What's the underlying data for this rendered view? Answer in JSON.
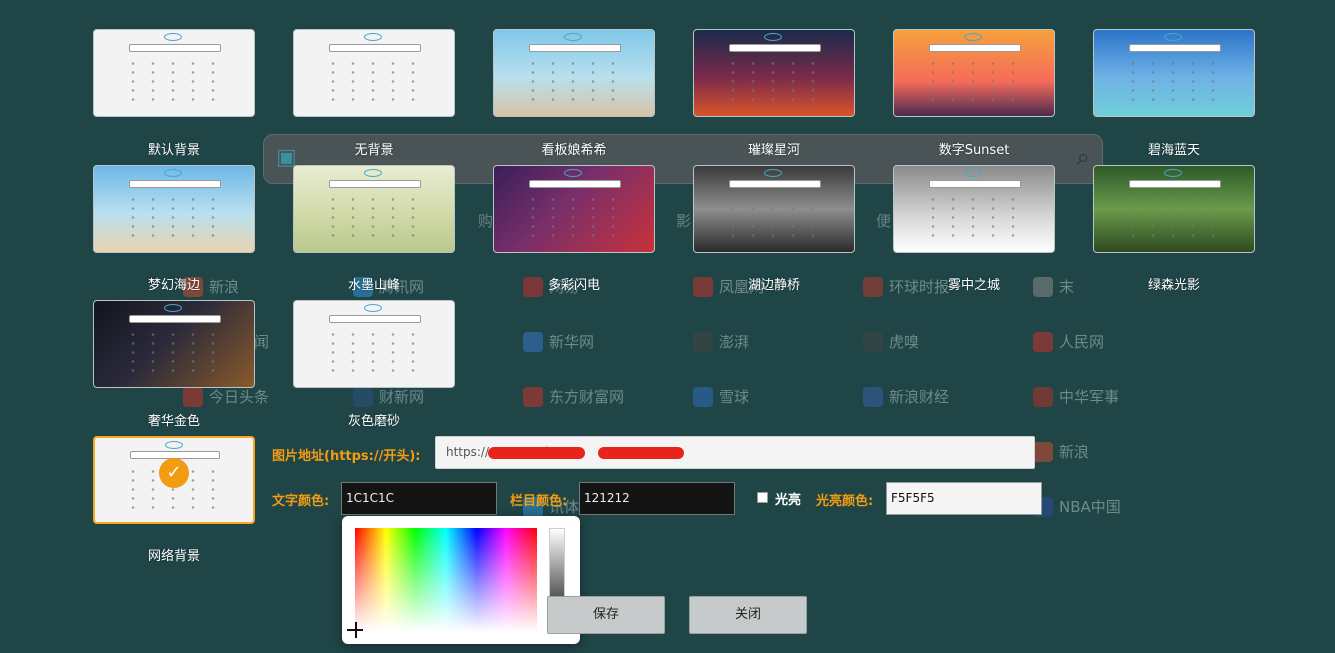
{
  "page": {
    "nav_hints": [
      "购",
      "影",
      "便"
    ],
    "sites": [
      {
        "label": "新浪",
        "color": "#d04a32"
      },
      {
        "label": "腾讯网",
        "color": "#2f8fd6"
      },
      {
        "label": "网易",
        "color": "#c72c2c"
      },
      {
        "label": "凤凰网",
        "color": "#c7322c"
      },
      {
        "label": "环球时报",
        "color": "#b23a2e"
      },
      {
        "label": "末",
        "color": "#888888"
      },
      {
        "label": "界面新闻",
        "color": "#c33a30"
      },
      {
        "label": "新华网",
        "color": "#3a75c4"
      },
      {
        "label": "澎湃",
        "color": "#444444"
      },
      {
        "label": "虎嗅",
        "color": "#444444"
      },
      {
        "label": "人民网",
        "color": "#c8322a"
      },
      {
        "label": "今日头条",
        "color": "#c8322a"
      },
      {
        "label": "财新网",
        "color": "#2e4e7e"
      },
      {
        "label": "东方财富网",
        "color": "#c8322a"
      },
      {
        "label": "雪球",
        "color": "#2e6cb6"
      },
      {
        "label": "新浪财经",
        "color": "#3a5fa6"
      },
      {
        "label": "中华军事",
        "color": "#b03226"
      },
      {
        "label": "新浪",
        "color": "#d04a32"
      },
      {
        "label": "讯体育",
        "color": "#2f8fd6"
      },
      {
        "label": "NBA中国",
        "color": "#2a4a9a"
      }
    ]
  },
  "themes": [
    {
      "caption": "默认背景",
      "bg": "#f3f3f3",
      "selected": false
    },
    {
      "caption": "无背景",
      "bg": "#f3f3f3",
      "selected": false
    },
    {
      "caption": "看板娘希希",
      "bg": "linear-gradient(180deg,#7fc7e8 0%,#b8e0ee 55%,#d9c3a6 100%)",
      "selected": false
    },
    {
      "caption": "璀璨星河",
      "bg": "linear-gradient(180deg,#1b2a4a 0%,#7a2a4a 55%,#d8542a 100%)",
      "selected": false
    },
    {
      "caption": "数字Sunset",
      "bg": "linear-gradient(180deg,#f6a13c 0%,#f56b5a 60%,#4b2a4f 100%)",
      "selected": false
    },
    {
      "caption": "碧海蓝天",
      "bg": "linear-gradient(180deg,#2c74c8 0%,#6fb2e6 55%,#6fcfd8 100%)",
      "selected": false
    },
    {
      "caption": "梦幻海边",
      "bg": "linear-gradient(180deg,#6db8e6 0%,#b9e0f0 55%,#e7d4ae 100%)",
      "selected": false
    },
    {
      "caption": "水墨山峰",
      "bg": "linear-gradient(180deg,#e9ecd2 0%,#cfd9a6 60%,#b9c88c 100%)",
      "selected": false
    },
    {
      "caption": "多彩闪电",
      "bg": "linear-gradient(135deg,#3a1f5a 0%,#7a2f6a 45%,#c9313a 100%)",
      "selected": false
    },
    {
      "caption": "湖边静桥",
      "bg": "linear-gradient(180deg,#3a3a3a 0%,#8e8e8e 50%,#2a2a2a 100%)",
      "selected": false
    },
    {
      "caption": "雾中之城",
      "bg": "linear-gradient(180deg,#8a8a8a 0%,#d8d8d8 60%,#ffffff 100%)",
      "selected": false
    },
    {
      "caption": "绿森光影",
      "bg": "linear-gradient(180deg,#2e5a2a 0%,#6a9a4a 50%,#2e4a22 100%)",
      "selected": false
    },
    {
      "caption": "奢华金色",
      "bg": "linear-gradient(135deg,#141420 0%,#2a2a3a 45%,#8a5a2a 100%)",
      "selected": false
    },
    {
      "caption": "灰色磨砂",
      "bg": "#f3f3f3",
      "selected": false
    },
    {
      "caption": "网络背景",
      "bg": "#f3f3f3",
      "selected": true
    }
  ],
  "form": {
    "url_label": "图片地址(https://开头):",
    "url_value": "https://                      /cus                    67Y.jpg",
    "text_color_label": "文字颜色:",
    "text_color_value": "1C1C1C",
    "bar_color_label": "栏目颜色:",
    "bar_color_value": "121212",
    "glow_label": "光亮",
    "glow_color_label": "光亮颜色:",
    "glow_color_value": "F5F5F5",
    "save_label": "保存",
    "close_label": "关闭"
  },
  "colors": {
    "accent": "#f39c12",
    "selected_border": "#f5a623",
    "redaction": "#e8231b"
  },
  "icons": {
    "selected": "check-icon",
    "search": "search-icon",
    "logo": "tv-logo-icon"
  }
}
